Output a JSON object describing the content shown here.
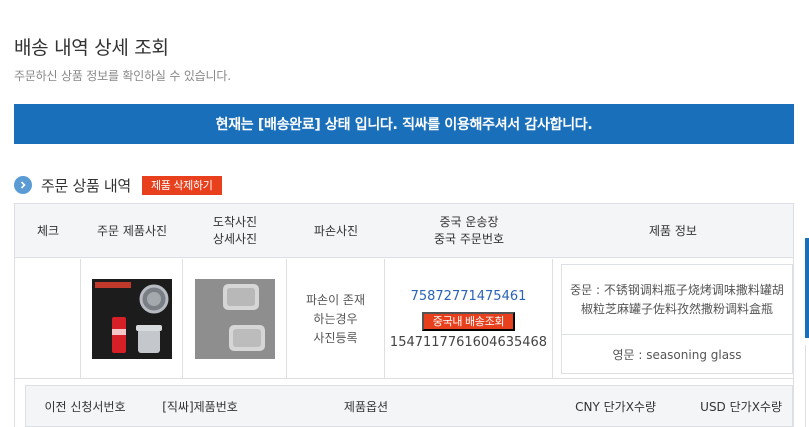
{
  "page": {
    "title": "배송 내역 상세 조회",
    "subtitle": "주문하신 상품 정보를 확인하실 수 있습니다."
  },
  "banner": {
    "text": "현재는 [배송완료] 상태 입니다. 직싸를 이용해주셔서 감사합니다.",
    "color": "#1a6fba"
  },
  "section": {
    "icon": "chevron-right-circle-icon",
    "title": "주문 상품 내역",
    "delete_label": "제품 삭제하기"
  },
  "table": {
    "headers": {
      "check": "체크",
      "order_photo": "주문 제품사진",
      "arrival_photo_1": "도착사진",
      "arrival_photo_2": "상세사진",
      "damage_photo": "파손사진",
      "tracking_1": "중국 운송장",
      "tracking_2": "중국 주문번호",
      "product_info": "제품 정보"
    },
    "row": {
      "damage_line1": "파손이 존재",
      "damage_line2": "하는경우",
      "damage_line3": "사진등록",
      "tracking_number": "75872771475461",
      "track_button": "중국내 배송조회",
      "order_number": "1547117761604635468",
      "product_cn": "중문 : 不锈钢调料瓶子烧烤调味撒料罐胡椒粒芝麻罐子佐料孜然撒粉调料盒瓶",
      "product_en": "영문 : seasoning glass"
    }
  },
  "subtable": {
    "headers": {
      "prev_request": "이전 신청서번호",
      "product_no": "[직싸]제품번호",
      "options": "제품옵션",
      "cny": "CNY 단가X수량",
      "usd": "USD 단가X수량"
    }
  },
  "colors": {
    "accent": "#e8401c",
    "link": "#2a63b8",
    "brand": "#1a6fba"
  }
}
